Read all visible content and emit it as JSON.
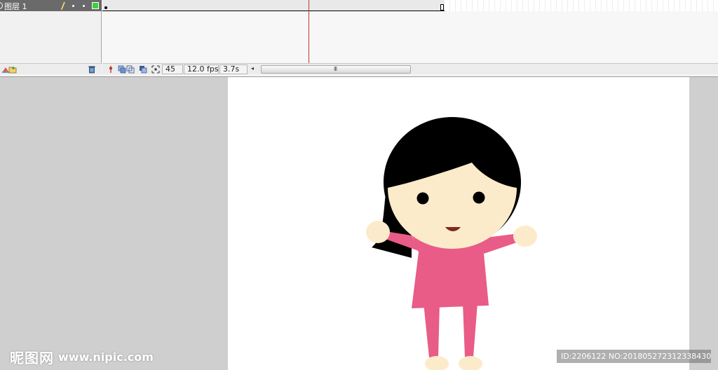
{
  "timeline": {
    "layer": {
      "name": "图层 1",
      "selected_color": "#6a6a6a",
      "outline_color": "#3ad23a"
    },
    "icons": {
      "layer_row": [
        "layer-type-icon",
        "pencil-icon",
        "eye-dot-icon",
        "lock-dot-icon",
        "outline-square-icon"
      ],
      "layer_tools": [
        "add-layer-icon",
        "add-folder-icon",
        "trash-icon"
      ],
      "frame_tools": [
        "center-frame-icon",
        "onion-skin-icon",
        "onion-skin-outline-icon",
        "edit-multiple-frames-icon",
        "modify-onion-markers-icon"
      ]
    },
    "status": {
      "current_frame": "45",
      "frame_rate": "12.0 fps",
      "elapsed": "3.7s"
    },
    "playhead_color": "#c0392b",
    "scroll_grip": "III"
  },
  "stage": {
    "background": "#ffffff",
    "pasteboard": "#cfcfcf",
    "character": {
      "hair_color": "#000000",
      "skin_color": "#fcebcb",
      "dress_color": "#e85c87",
      "mouth_color": "#7b2b1e"
    }
  },
  "watermark": {
    "logo_text": "昵图网",
    "url": "www.nipic.com",
    "id_text": "ID:2206122 NO:20180527231233843000"
  }
}
